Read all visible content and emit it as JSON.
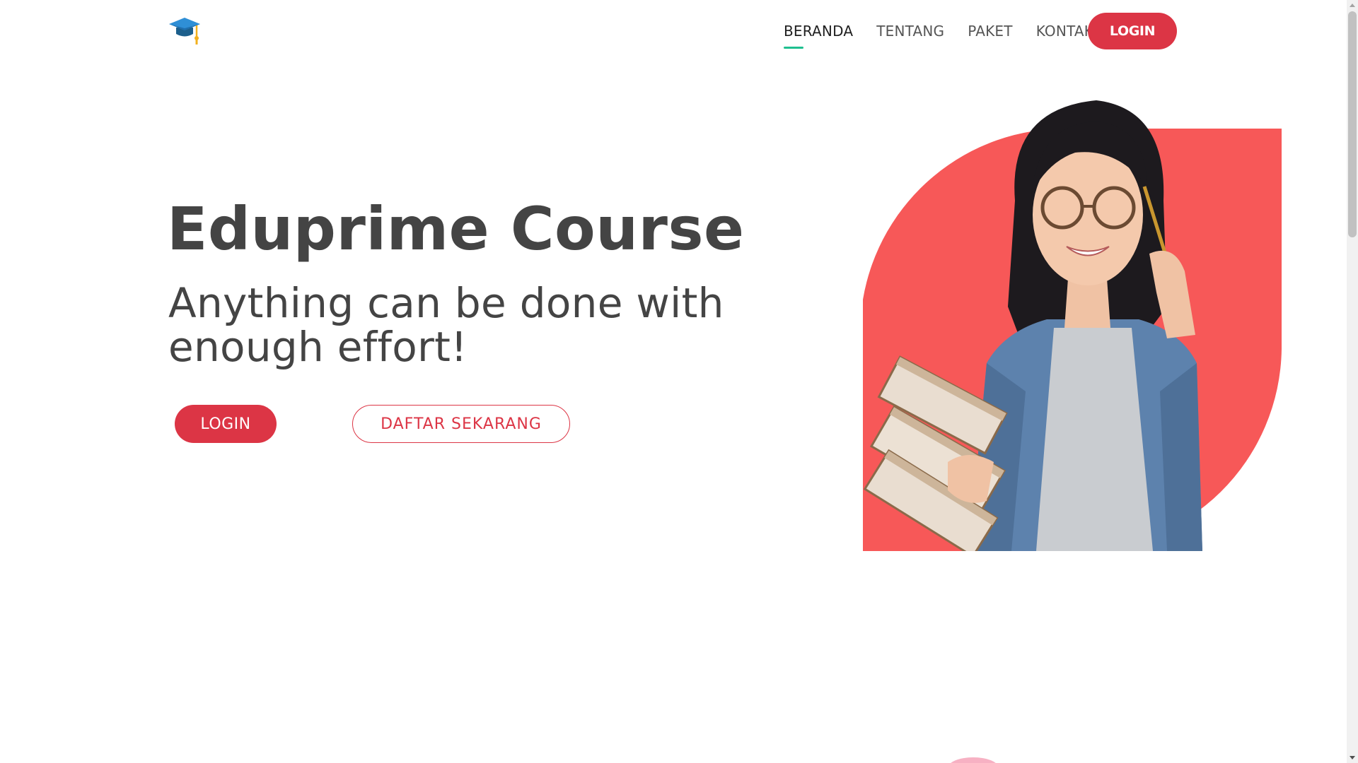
{
  "colors": {
    "brand_red": "#dc3545",
    "accent_green": "#1fbf8f",
    "hero_shape": "#f75858",
    "text_dark": "#444444"
  },
  "navbar": {
    "logo_icon": "graduation-cap-icon",
    "links": [
      {
        "label": "BERANDA",
        "active": true
      },
      {
        "label": "TENTANG",
        "active": false
      },
      {
        "label": "PAKET",
        "active": false
      },
      {
        "label": "KONTAK",
        "active": false
      }
    ],
    "login_label": "LOGIN"
  },
  "hero": {
    "title": "Eduprime Course",
    "subtitle": "Anything can be done with enough effort!",
    "login_label": "LOGIN",
    "register_label": "DAFTAR SEKARANG",
    "image_icon": "student-with-books-photo"
  }
}
